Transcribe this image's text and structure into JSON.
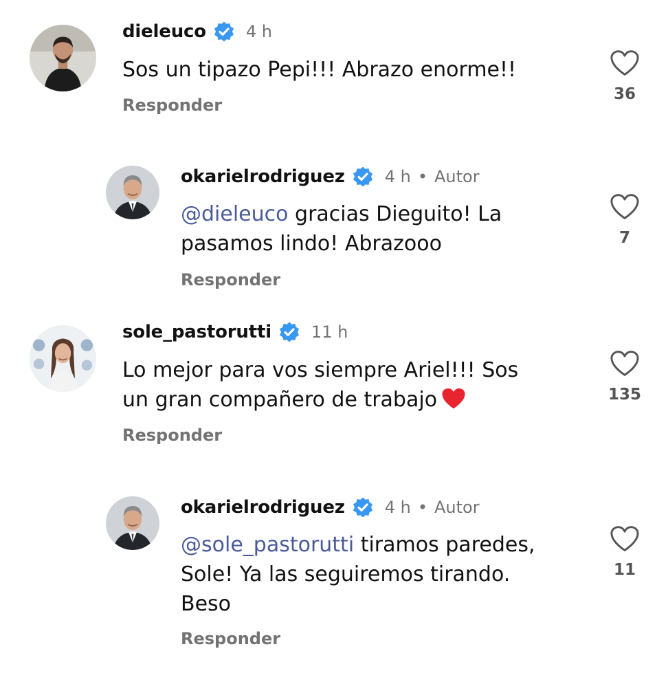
{
  "comments": [
    {
      "username": "dieleuco",
      "time": "4 h",
      "text_lines": [
        "Sos un tipazo Pepi!!! Abrazo enorme!!"
      ],
      "reply_label": "Responder",
      "like_count": "36",
      "avatar": "man-dark-shirt-avatar"
    },
    {
      "username": "okarielrodriguez",
      "time": "4 h",
      "separator": "•",
      "author_label": "Autor",
      "mention": "@dieleuco",
      "text_lines": [
        " gracias Dieguito! La",
        "pasamos lindo! Abrazooo"
      ],
      "reply_label": "Responder",
      "like_count": "7",
      "avatar": "man-suit-avatar"
    },
    {
      "username": "sole_pastorutti",
      "time": "11 h",
      "text_lines": [
        "Lo mejor para vos siempre Ariel!!! Sos",
        "un gran compañero de trabajo"
      ],
      "emoji": "red-heart-emoji",
      "reply_label": "Responder",
      "like_count": "135",
      "avatar": "woman-long-hair-avatar"
    },
    {
      "username": "okarielrodriguez",
      "time": "4 h",
      "separator": "•",
      "author_label": "Autor",
      "mention": "@sole_pastorutti",
      "text_lines": [
        " tiramos paredes,",
        "Sole! Ya las seguiremos tirando.",
        "Beso"
      ],
      "reply_label": "Responder",
      "like_count": "11",
      "avatar": "man-suit-avatar"
    }
  ],
  "colors": {
    "verified_badge": "#3897f0",
    "mention": "#4a5b9b",
    "secondary_text": "#737373",
    "heart_emoji": "#e8242f"
  }
}
